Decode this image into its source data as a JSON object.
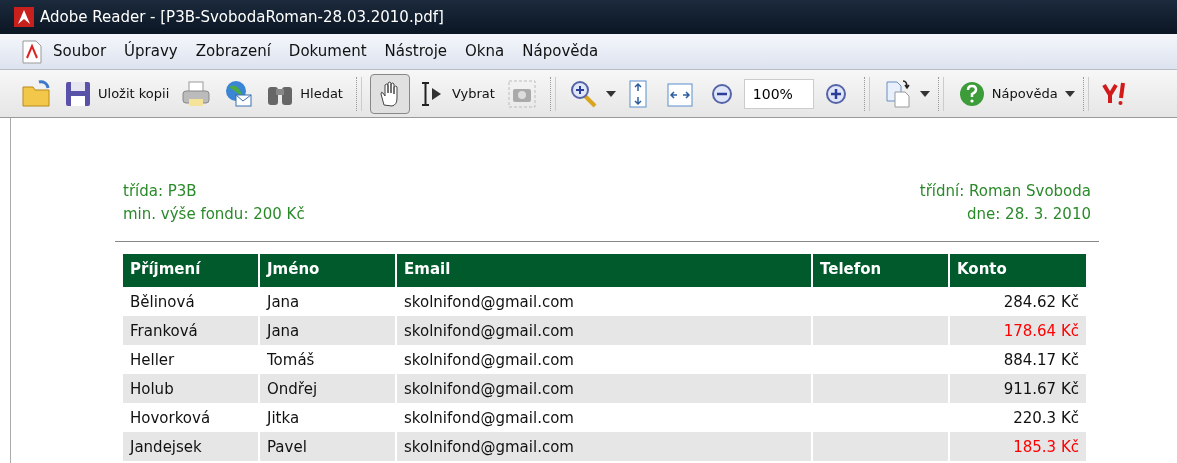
{
  "window": {
    "title": "Adobe Reader - [P3B-SvobodaRoman-28.03.2010.pdf]"
  },
  "menu": [
    "Soubor",
    "Úpravy",
    "Zobrazení",
    "Dokument",
    "Nástroje",
    "Okna",
    "Nápověda"
  ],
  "toolbar": [
    {
      "kind": "tool",
      "pressed": false
    },
    {
      "kind": "tool",
      "label": "Uložit kopii",
      "pressed": false
    },
    {
      "kind": "tool",
      "pressed": false
    },
    {
      "kind": "tool",
      "pressed": false
    },
    {
      "kind": "tool",
      "label": "Hledat",
      "pressed": false
    },
    {
      "kind": "separator"
    },
    {
      "kind": "tool",
      "pressed": true
    },
    {
      "kind": "tool",
      "label": "Vybrat",
      "pressed": false
    },
    {
      "kind": "tool",
      "pressed": false
    },
    {
      "kind": "separator"
    },
    {
      "kind": "tool",
      "pressed": false,
      "dropdown": true
    },
    {
      "kind": "tool",
      "pressed": false
    },
    {
      "kind": "tool",
      "pressed": false
    },
    {
      "kind": "tool",
      "pressed": false
    },
    {
      "kind": "zoom",
      "value": "100%"
    },
    {
      "kind": "tool",
      "pressed": false
    },
    {
      "kind": "separator"
    },
    {
      "kind": "tool",
      "pressed": false,
      "dropdown": true
    },
    {
      "kind": "separator"
    },
    {
      "kind": "tool",
      "label": "Nápověda",
      "pressed": false,
      "dropdown": true
    },
    {
      "kind": "separator"
    },
    {
      "kind": "tool",
      "pressed": false
    }
  ],
  "document": {
    "header_left": [
      "třída: P3B",
      "min. výše fondu: 200 Kč"
    ],
    "header_right": [
      "třídní: Roman Svoboda",
      "dne: 28. 3. 2010"
    ],
    "table": {
      "columns": [
        "Příjmení",
        "Jméno",
        "Email",
        "Telefon",
        "Konto"
      ],
      "rows": [
        {
          "cells": [
            "Bělinová",
            "Jana",
            "skolnifond@gmail.com",
            "",
            "284.62 Kč"
          ],
          "below_minimum": false
        },
        {
          "cells": [
            "Franková",
            "Jana",
            "skolnifond@gmail.com",
            "",
            "178.64 Kč"
          ],
          "below_minimum": true
        },
        {
          "cells": [
            "Heller",
            "Tomáš",
            "skolnifond@gmail.com",
            "",
            "884.17 Kč"
          ],
          "below_minimum": false
        },
        {
          "cells": [
            "Holub",
            "Ondřej",
            "skolnifond@gmail.com",
            "",
            "911.67 Kč"
          ],
          "below_minimum": false
        },
        {
          "cells": [
            "Hovorková",
            "Jitka",
            "skolnifond@gmail.com",
            "",
            "220.3 Kč"
          ],
          "below_minimum": false
        },
        {
          "cells": [
            "Jandejsek",
            "Pavel",
            "skolnifond@gmail.com",
            "",
            "185.3 Kč"
          ],
          "below_minimum": true
        }
      ]
    }
  }
}
